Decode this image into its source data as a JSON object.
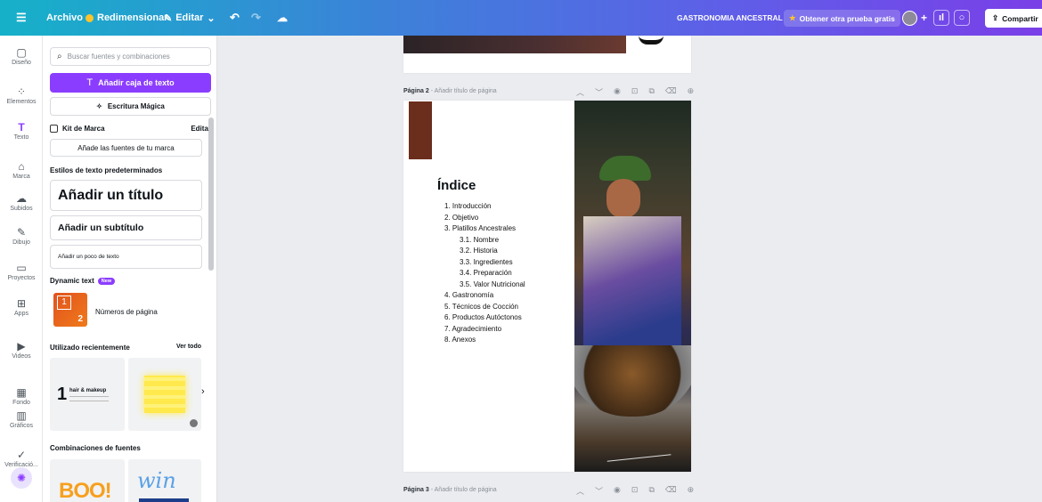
{
  "topbar": {
    "menu_icon": "hamburger-icon",
    "file": "Archivo",
    "resize": "Redimensionar",
    "edit": "Editar",
    "doc_title": "GASTRONOMIA ANCESTRAL",
    "trial": "Obtener otra prueba gratis",
    "share": "Compartir"
  },
  "rail": [
    {
      "label": "Diseño",
      "icon": "layout-icon"
    },
    {
      "label": "Elementos",
      "icon": "elements-icon"
    },
    {
      "label": "Texto",
      "icon": "text-icon"
    },
    {
      "label": "Marca",
      "icon": "brand-icon"
    },
    {
      "label": "Subidos",
      "icon": "upload-icon"
    },
    {
      "label": "Dibujo",
      "icon": "draw-icon"
    },
    {
      "label": "Proyectos",
      "icon": "folder-icon"
    },
    {
      "label": "Apps",
      "icon": "apps-icon"
    },
    {
      "label": "Videos",
      "icon": "video-icon"
    },
    {
      "label": "Fondo",
      "icon": "background-icon"
    },
    {
      "label": "Gráficos",
      "icon": "chart-icon"
    },
    {
      "label": "Verificació...",
      "icon": "check-icon"
    }
  ],
  "panel": {
    "search_placeholder": "Buscar fuentes y combinaciones",
    "add_textbox": "Añadir caja de texto",
    "magic_write": "Escritura Mágica",
    "brand_kit": "Kit de Marca",
    "edit": "Editar",
    "add_brand_fonts": "Añade las fuentes de tu marca",
    "default_styles": "Estilos de texto predeterminados",
    "add_title": "Añadir un título",
    "add_subtitle": "Añadir un subtítulo",
    "add_body": "Añadir un poco de texto",
    "dynamic_text": "Dynamic text",
    "new_badge": "New",
    "page_numbers": "Números de página",
    "recent": "Utilizado recientemente",
    "see_all": "Ver todo",
    "recent_item_title": "hair & makeup",
    "font_combos": "Combinaciones de fuentes",
    "combo1": "BOO!",
    "combo2": "win"
  },
  "pages": {
    "page2_label": "Página 2",
    "page2_title": "Añadir título de página",
    "page3_label": "Página 3",
    "page3_title": "Añadir título de página"
  },
  "toc": {
    "heading": "Índice",
    "items": [
      "1. Introducción",
      "2. Objetivo",
      "3. Platillos Ancestrales",
      "3.1. Nombre",
      "3.2. Historia",
      "3.3. Ingredientes",
      "3.4. Preparación",
      "3.5. Valor Nutricional",
      "4. Gastronomía",
      "5. Técnicos de Cocción",
      "6. Productos Autóctonos",
      "7. Agradecimiento",
      "8. Anexos"
    ]
  },
  "colors": {
    "accent": "#8b3dff",
    "brown": "#6b2d1c"
  }
}
